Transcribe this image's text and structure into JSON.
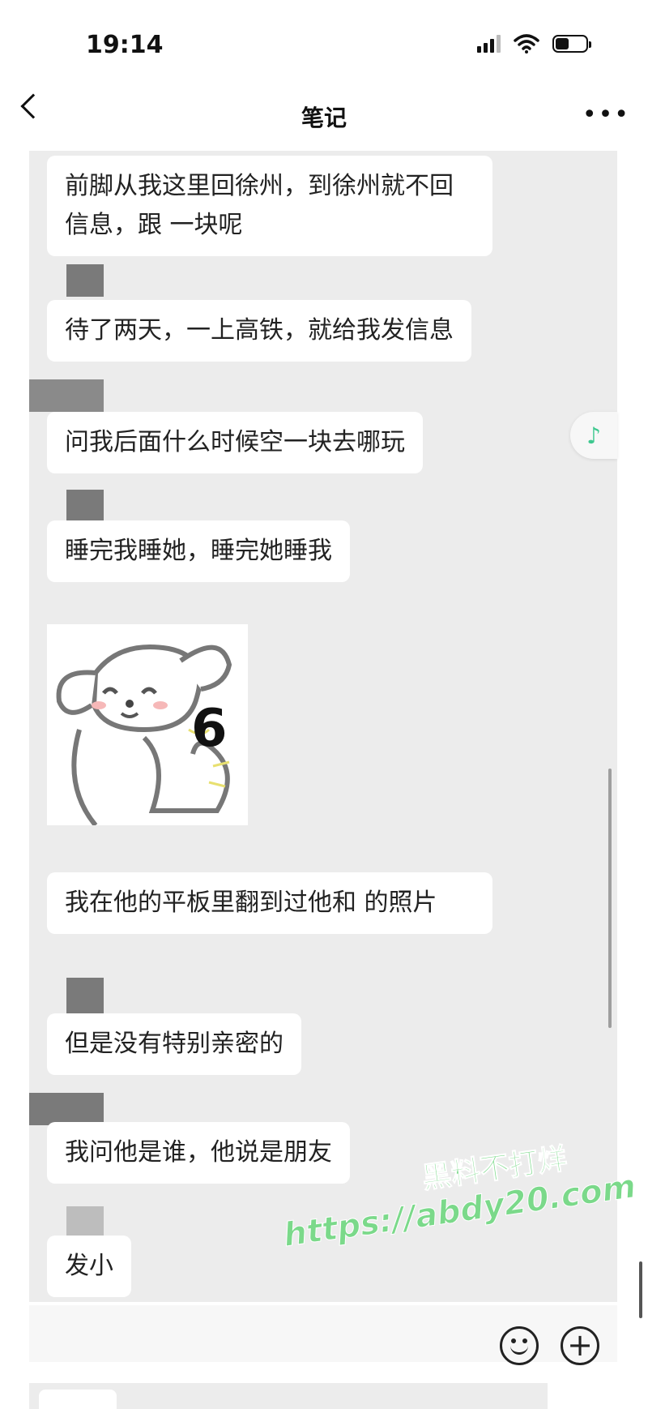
{
  "status_bar": {
    "time": "19:14"
  },
  "nav": {
    "title": "笔记"
  },
  "messages": [
    {
      "text": "前脚从我这里回徐州，到徐州就不回信息，跟     一块呢"
    },
    {
      "text": "待了两天，一上高铁，就给我发信息"
    },
    {
      "text": "问我后面什么时候空一块去哪玩"
    },
    {
      "text": "睡完我睡她，睡完她睡我"
    },
    {
      "text": "我在他的平板里翻到过他和     的照片"
    },
    {
      "text": "但是没有特别亲密的"
    },
    {
      "text": "我问他是谁，他说是朋友"
    },
    {
      "text": "发小"
    }
  ],
  "sticker": {
    "label": "6",
    "icon": "dog-thumbs-up-sticker"
  },
  "watermark": {
    "line1": "黑料不打烊",
    "line2": "https://abdy20.com"
  },
  "icons": {
    "music": "music-note-icon",
    "emoji": "emoji-icon",
    "plus": "plus-icon"
  },
  "colors": {
    "canvas_bg": "#ececec",
    "bubble_bg": "#ffffff",
    "accent_music": "#3ec88f",
    "watermark": "#7bd98a"
  }
}
